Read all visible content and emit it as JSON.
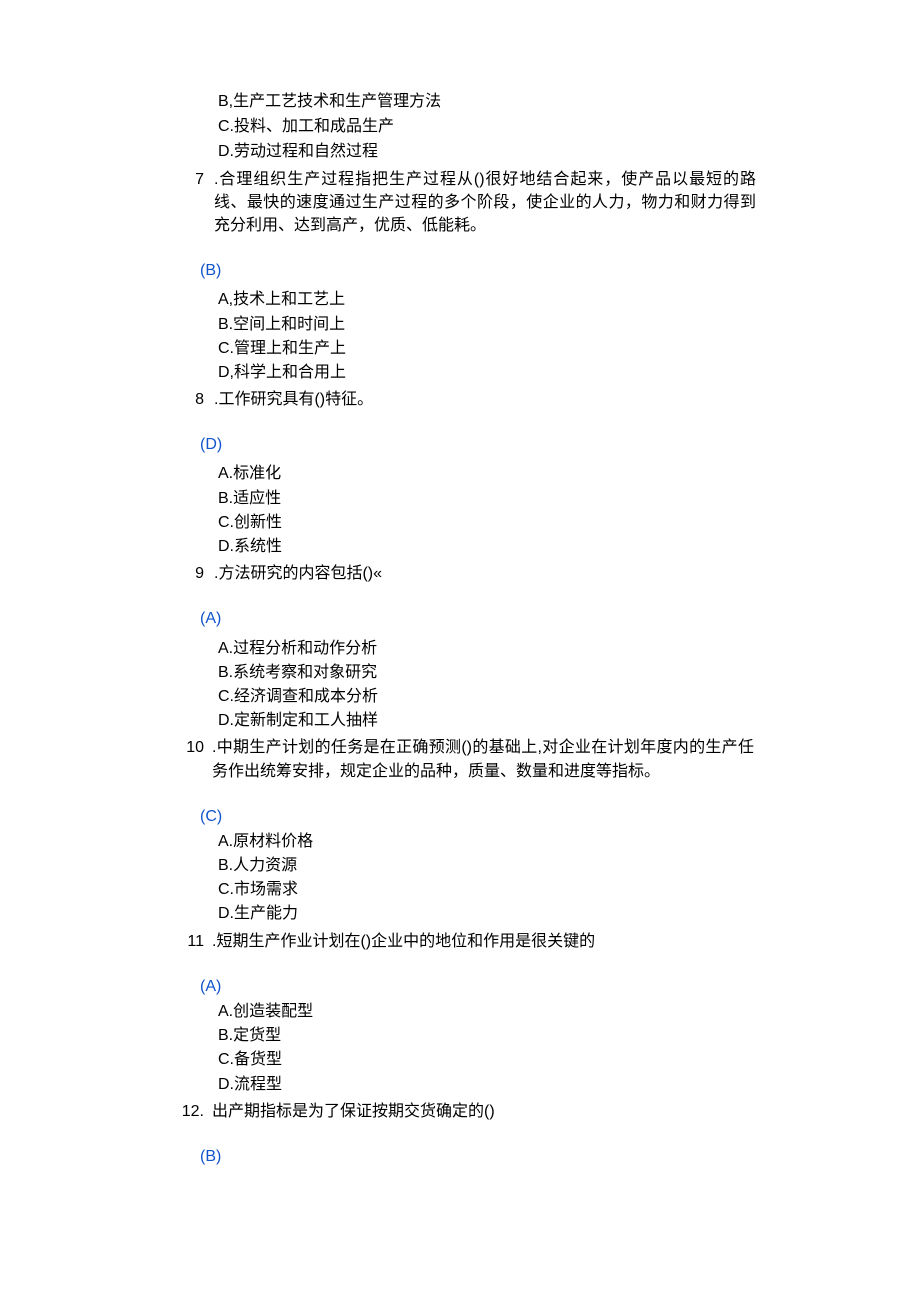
{
  "orphan": {
    "b": "B,生产工艺技术和生产管理方法",
    "c": "C.投料、加工和成品生产",
    "d": "D.劳动过程和自然过程"
  },
  "q7": {
    "num": "7",
    "stem": ".合理组织生产过程指把生产过程从()很好地结合起来，使产品以最短的路线、最快的速度通过生产过程的多个阶段，使企业的人力，物力和财力得到充分利用、达到高产，优质、低能耗。",
    "answer": "(B)",
    "a": "A,技术上和工艺上",
    "b": "B.空间上和时间上",
    "c": "C.管理上和生产上",
    "d": "D,科学上和合用上"
  },
  "q8": {
    "num": "8",
    "stem": ".工作研究具有()特征。",
    "answer": "(D)",
    "a": "A.标准化",
    "b": "B.适应性",
    "c": "C.创新性",
    "d": "D.系统性"
  },
  "q9": {
    "num": "9",
    "stem": ".方法研究的内容包括()«",
    "answer": "(A)",
    "a": "A.过程分析和动作分析",
    "b": "B.系统考察和对象研究",
    "c": "C.经济调查和成本分析",
    "d": "D.定新制定和工人抽样"
  },
  "q10": {
    "num": "10",
    "stem": ".中期生产计划的任务是在正确预测()的基础上,对企业在计划年度内的生产任务作出统筹安排，规定企业的品种，质量、数量和进度等指标。",
    "answer": "(C)",
    "a": "A.原材料价格",
    "b": "B.人力资源",
    "c": "C.市场需求",
    "d": "D.生产能力"
  },
  "q11": {
    "num": "11",
    "stem": ".短期生产作业计划在()企业中的地位和作用是很关键的",
    "answer": "(A)",
    "a": "A.创造装配型",
    "b": "B.定货型",
    "c": "C.备货型",
    "d": "D.流程型"
  },
  "q12": {
    "num": "12.",
    "stem": "出产期指标是为了保证按期交货确定的()",
    "answer": "(B)"
  }
}
